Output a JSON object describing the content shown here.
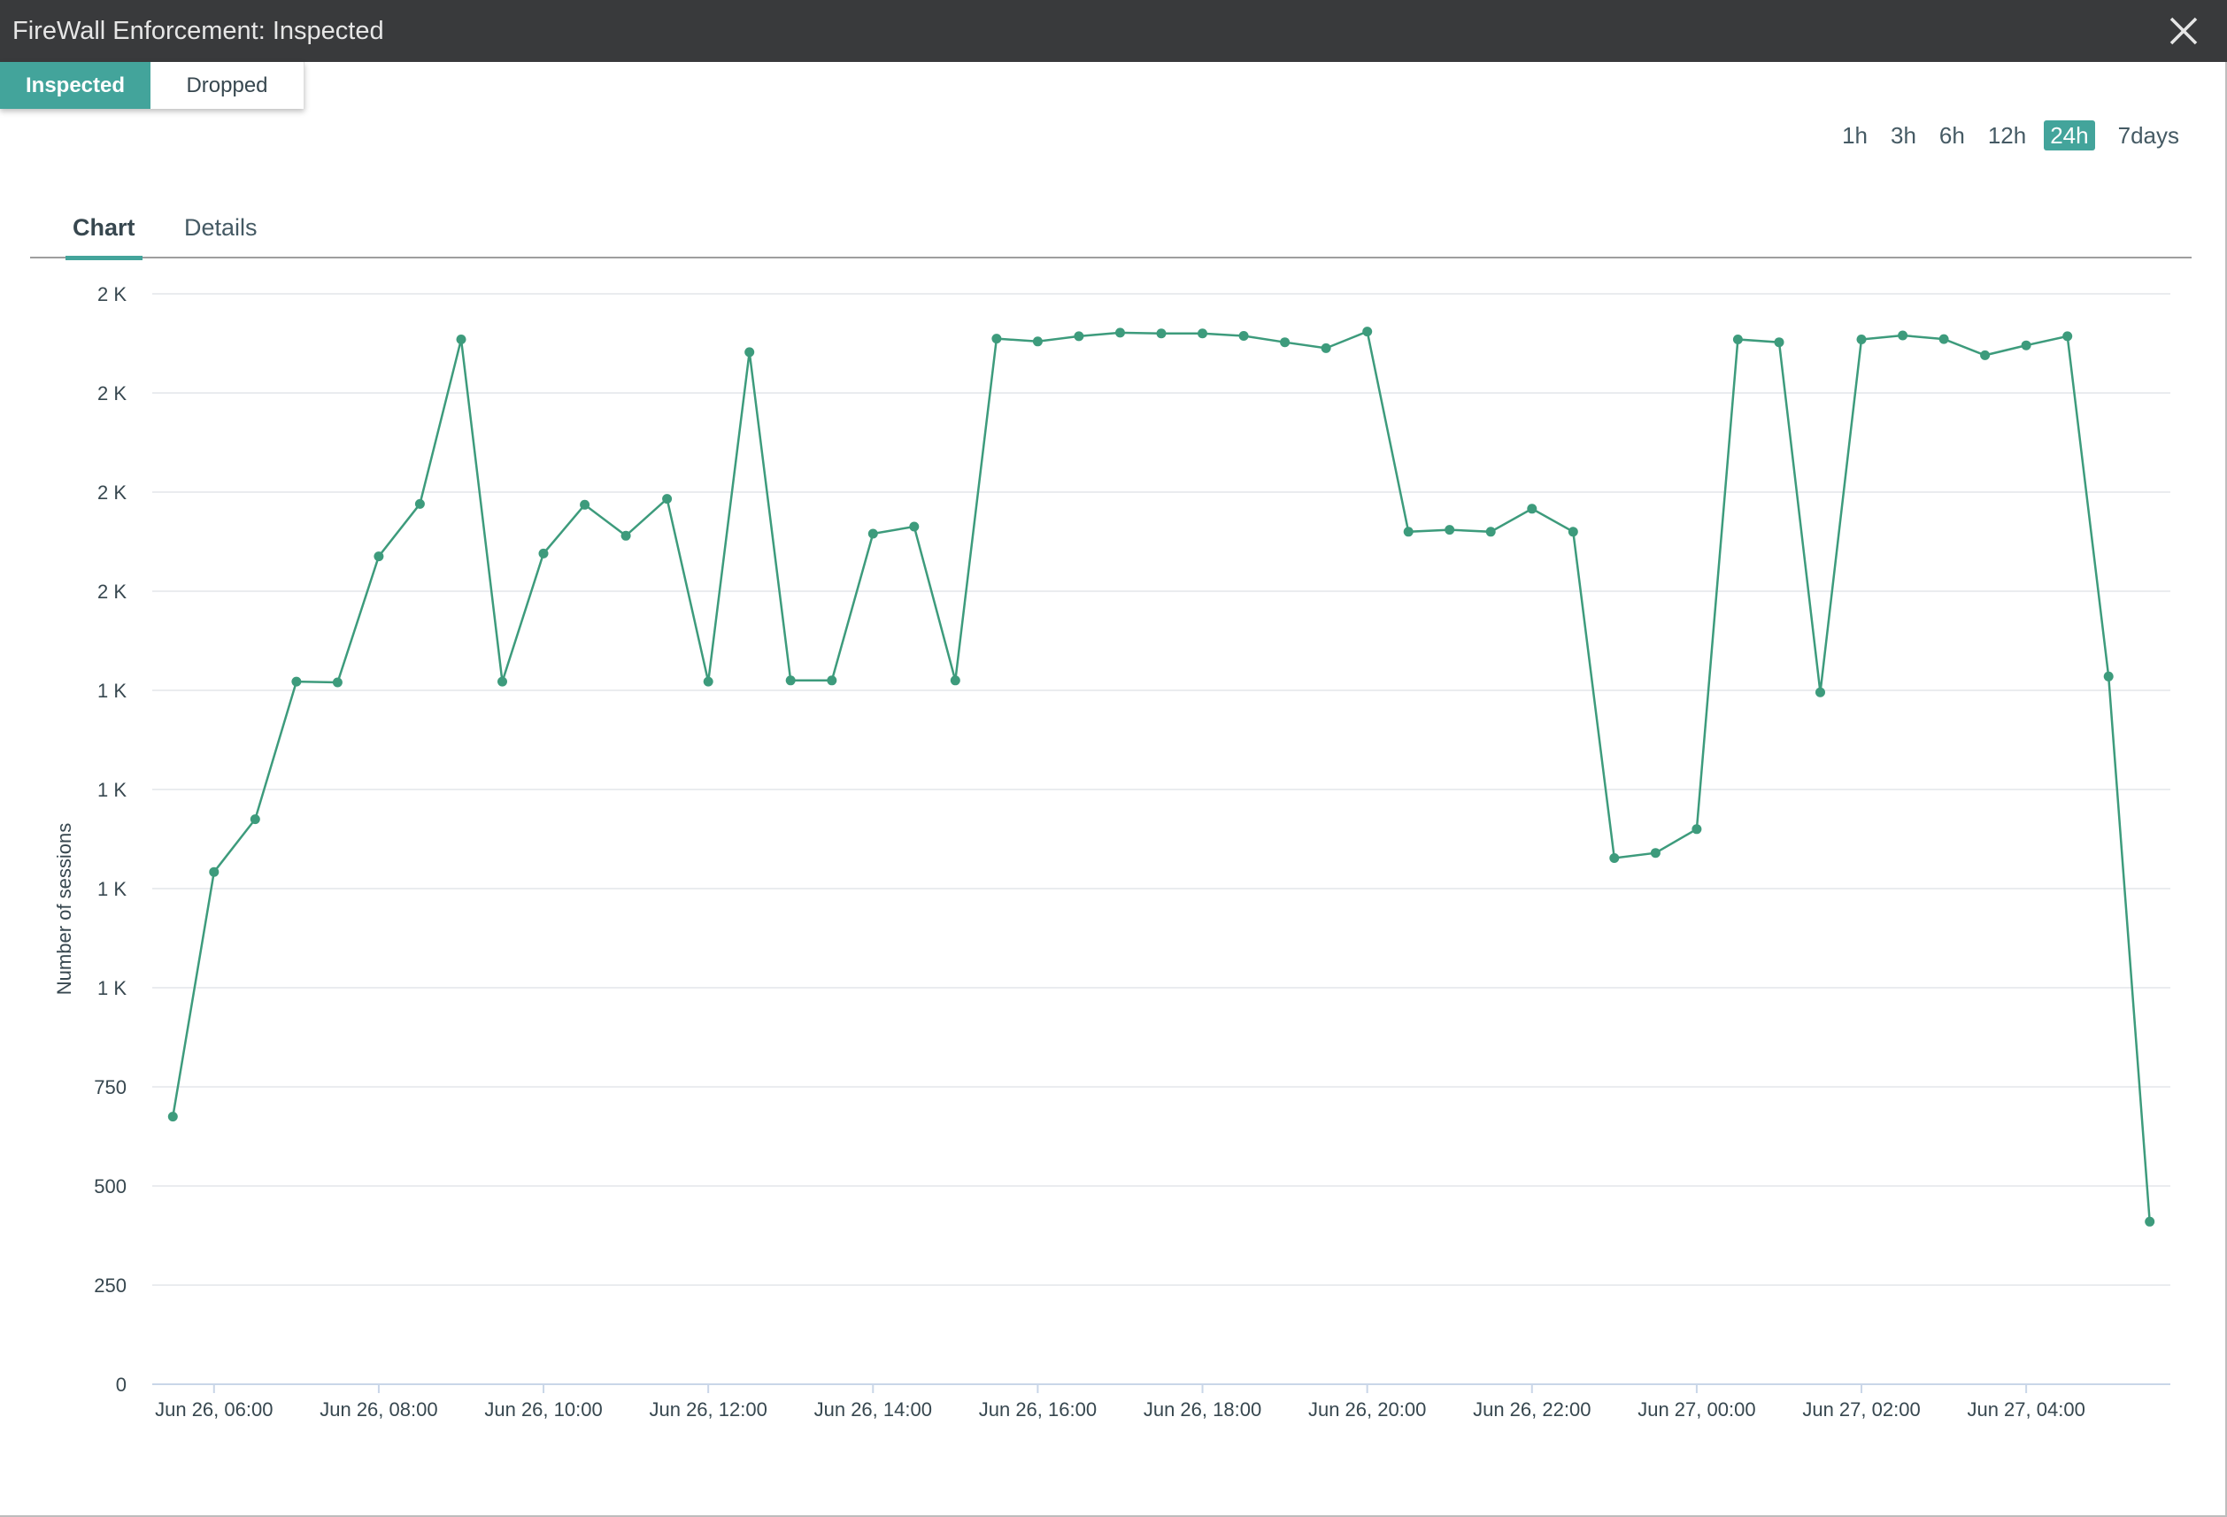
{
  "window": {
    "title": "FireWall Enforcement: Inspected"
  },
  "icons": {
    "close": "close-icon"
  },
  "segment": {
    "options": [
      {
        "label": "Inspected",
        "active": true
      },
      {
        "label": "Dropped",
        "active": false
      }
    ]
  },
  "time_ranges": {
    "options": [
      "1h",
      "3h",
      "6h",
      "12h",
      "24h",
      "7days"
    ],
    "selected": "24h"
  },
  "view_tabs": {
    "tabs": [
      {
        "label": "Chart",
        "active": true
      },
      {
        "label": "Details",
        "active": false
      }
    ]
  },
  "colors": {
    "accent": "#43a49b",
    "line": "#3d9b7c",
    "grid": "#e3e6ea",
    "titlebar": "#393a3c"
  },
  "chart_data": {
    "type": "line",
    "ylabel": "Number of sessions",
    "xlabel": "",
    "grid": true,
    "ylim": [
      0,
      2750
    ],
    "y_ticks": [
      0,
      250,
      500,
      750,
      1000,
      1250,
      1500,
      1750,
      2000,
      2250,
      2500,
      2750
    ],
    "y_tick_labels": [
      "0",
      "250",
      "500",
      "750",
      "1 K",
      "1 K",
      "1 K",
      "1 K",
      "2 K",
      "2 K",
      "2 K",
      "2 K"
    ],
    "x_ticks": [
      "Jun 26, 06:00",
      "Jun 26, 08:00",
      "Jun 26, 10:00",
      "Jun 26, 12:00",
      "Jun 26, 14:00",
      "Jun 26, 16:00",
      "Jun 26, 18:00",
      "Jun 26, 20:00",
      "Jun 26, 22:00",
      "Jun 27, 00:00",
      "Jun 27, 02:00",
      "Jun 27, 04:00"
    ],
    "x_range": [
      "Jun 26, 05:15",
      "Jun 27, 05:45"
    ],
    "series": [
      {
        "x": [
          "Jun 26, 05:30",
          "Jun 26, 06:00",
          "Jun 26, 06:30",
          "Jun 26, 07:00",
          "Jun 26, 07:30",
          "Jun 26, 08:00",
          "Jun 26, 08:30",
          "Jun 26, 09:00",
          "Jun 26, 09:30",
          "Jun 26, 10:00",
          "Jun 26, 10:30",
          "Jun 26, 11:00",
          "Jun 26, 11:30",
          "Jun 26, 12:00",
          "Jun 26, 12:30",
          "Jun 26, 13:00",
          "Jun 26, 13:30",
          "Jun 26, 14:00",
          "Jun 26, 14:30",
          "Jun 26, 15:00",
          "Jun 26, 15:30",
          "Jun 26, 16:00",
          "Jun 26, 16:30",
          "Jun 26, 17:00",
          "Jun 26, 17:30",
          "Jun 26, 18:00",
          "Jun 26, 18:30",
          "Jun 26, 19:00",
          "Jun 26, 19:30",
          "Jun 26, 20:00",
          "Jun 26, 20:30",
          "Jun 26, 21:00",
          "Jun 26, 21:30",
          "Jun 26, 22:00",
          "Jun 26, 22:30",
          "Jun 26, 23:00",
          "Jun 26, 23:30",
          "Jun 27, 00:00",
          "Jun 27, 00:30",
          "Jun 27, 01:00",
          "Jun 27, 01:30",
          "Jun 27, 02:00",
          "Jun 27, 02:30",
          "Jun 27, 03:00",
          "Jun 27, 03:30",
          "Jun 27, 04:00",
          "Jun 27, 04:30",
          "Jun 27, 05:00",
          "Jun 27, 05:30"
        ],
        "values": [
          675,
          1292,
          1425,
          1772,
          1770,
          2088,
          2220,
          2635,
          1772,
          2095,
          2218,
          2140,
          2233,
          1772,
          2603,
          1775,
          1775,
          2145,
          2163,
          1775,
          2637,
          2630,
          2643,
          2652,
          2650,
          2650,
          2644,
          2628,
          2613,
          2655,
          2150,
          2155,
          2150,
          2208,
          2150,
          1327,
          1340,
          1400,
          2635,
          2628,
          1745,
          2635,
          2645,
          2636,
          2595,
          2620,
          2643,
          1785,
          410
        ]
      }
    ]
  }
}
